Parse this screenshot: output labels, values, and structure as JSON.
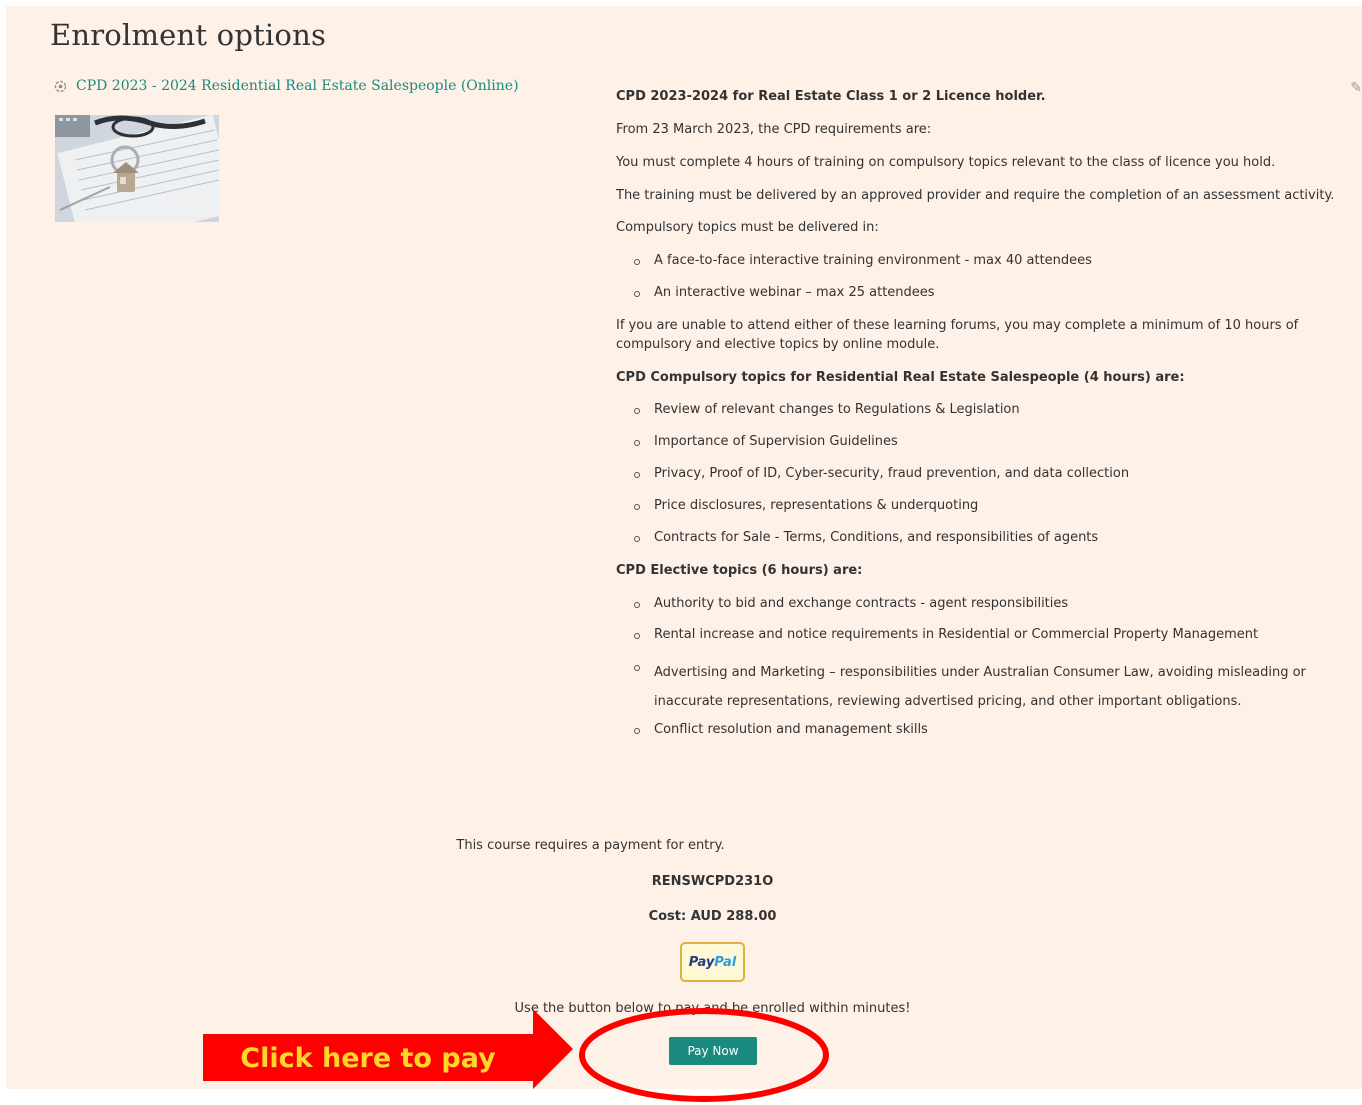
{
  "page": {
    "title": "Enrolment options"
  },
  "course": {
    "link_label": "CPD 2023 - 2024 Residential Real Estate Salespeople (Online)",
    "image_icon": "keys-on-documents-photo",
    "top_right_icon": "pencil-edit-icon"
  },
  "summary": {
    "heading": "CPD 2023-2024 for Real Estate Class 1 or 2 Licence holder.",
    "p1": "From 23 March 2023, the CPD requirements are:",
    "p2": "You must complete 4 hours of training on compulsory topics relevant to the class of licence you hold.",
    "p3": "The training must be delivered by an approved provider and require the completion of an assessment activity.",
    "p4": "Compulsory topics must be delivered in:",
    "delivery": [
      "A face-to-face interactive training environment - max 40 attendees",
      "An interactive webinar – max 25 attendees"
    ],
    "p5": "If you are unable to attend either of these learning forums, you may complete a minimum of 10 hours of compulsory and elective topics by online module.",
    "compulsory_heading": "CPD Compulsory topics for Residential Real Estate Salespeople (4 hours) are:",
    "compulsory": [
      "Review of relevant changes to Regulations & Legislation",
      "Importance of Supervision Guidelines",
      "Privacy, Proof of ID, Cyber-security, fraud prevention, and data collection",
      "Price disclosures, representations & underquoting",
      "Contracts for Sale - Terms, Conditions, and responsibilities of agents"
    ],
    "elective_heading": "CPD Elective topics (6 hours) are:",
    "elective": [
      "Authority to bid and exchange contracts - agent responsibilities",
      "Rental increase and notice requirements in Residential or Commercial Property Management",
      "Advertising and Marketing – responsibilities under Australian Consumer Law, avoiding misleading or inaccurate representations, reviewing advertised pricing, and other important obligations.",
      "Conflict resolution and management skills"
    ]
  },
  "payment": {
    "requires": "This course requires a payment for entry.",
    "code": "RENSWCPD231O",
    "cost": "Cost: AUD 288.00",
    "paypal_pay": "Pay",
    "paypal_pal": "Pal",
    "instructions": "Use the button below to pay and be enrolled within minutes!",
    "button": "Pay Now"
  },
  "annotation": {
    "callout": "Click here to pay",
    "arrow_color": "#ff0000",
    "text_color": "#ffd72a"
  },
  "colors": {
    "background": "#fdf1e8",
    "link": "#1c8a7e",
    "button": "#1b8a7e"
  }
}
